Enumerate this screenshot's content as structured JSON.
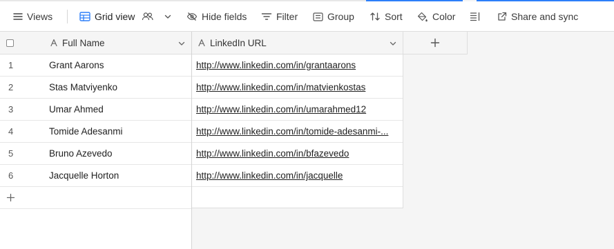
{
  "colors": {
    "accent": "#2d7ff9",
    "background": "#f5f5f5",
    "grid_line": "#dedede"
  },
  "toolbar": {
    "views_label": "Views",
    "view_name": "Grid view",
    "hide_fields_label": "Hide fields",
    "filter_label": "Filter",
    "group_label": "Group",
    "sort_label": "Sort",
    "color_label": "Color",
    "share_label": "Share and sync"
  },
  "grid": {
    "columns": [
      {
        "label": "Full Name",
        "type_icon": "text-field-icon"
      },
      {
        "label": "LinkedIn URL",
        "type_icon": "text-field-icon"
      }
    ],
    "add_column_icon": "plus-icon",
    "add_row_icon": "plus-icon",
    "rows": [
      {
        "num": "1",
        "name": "Grant Aarons",
        "url": "http://www.linkedin.com/in/grantaarons"
      },
      {
        "num": "2",
        "name": "Stas Matviyenko",
        "url": "http://www.linkedin.com/in/matvienkostas"
      },
      {
        "num": "3",
        "name": "Umar Ahmed",
        "url": "http://www.linkedin.com/in/umarahmed12"
      },
      {
        "num": "4",
        "name": "Tomide Adesanmi",
        "url": "http://www.linkedin.com/in/tomide-adesanmi-..."
      },
      {
        "num": "5",
        "name": "Bruno Azevedo",
        "url": "http://www.linkedin.com/in/bfazevedo"
      },
      {
        "num": "6",
        "name": "Jacquelle Horton",
        "url": "http://www.linkedin.com/in/jacquelle"
      }
    ]
  }
}
